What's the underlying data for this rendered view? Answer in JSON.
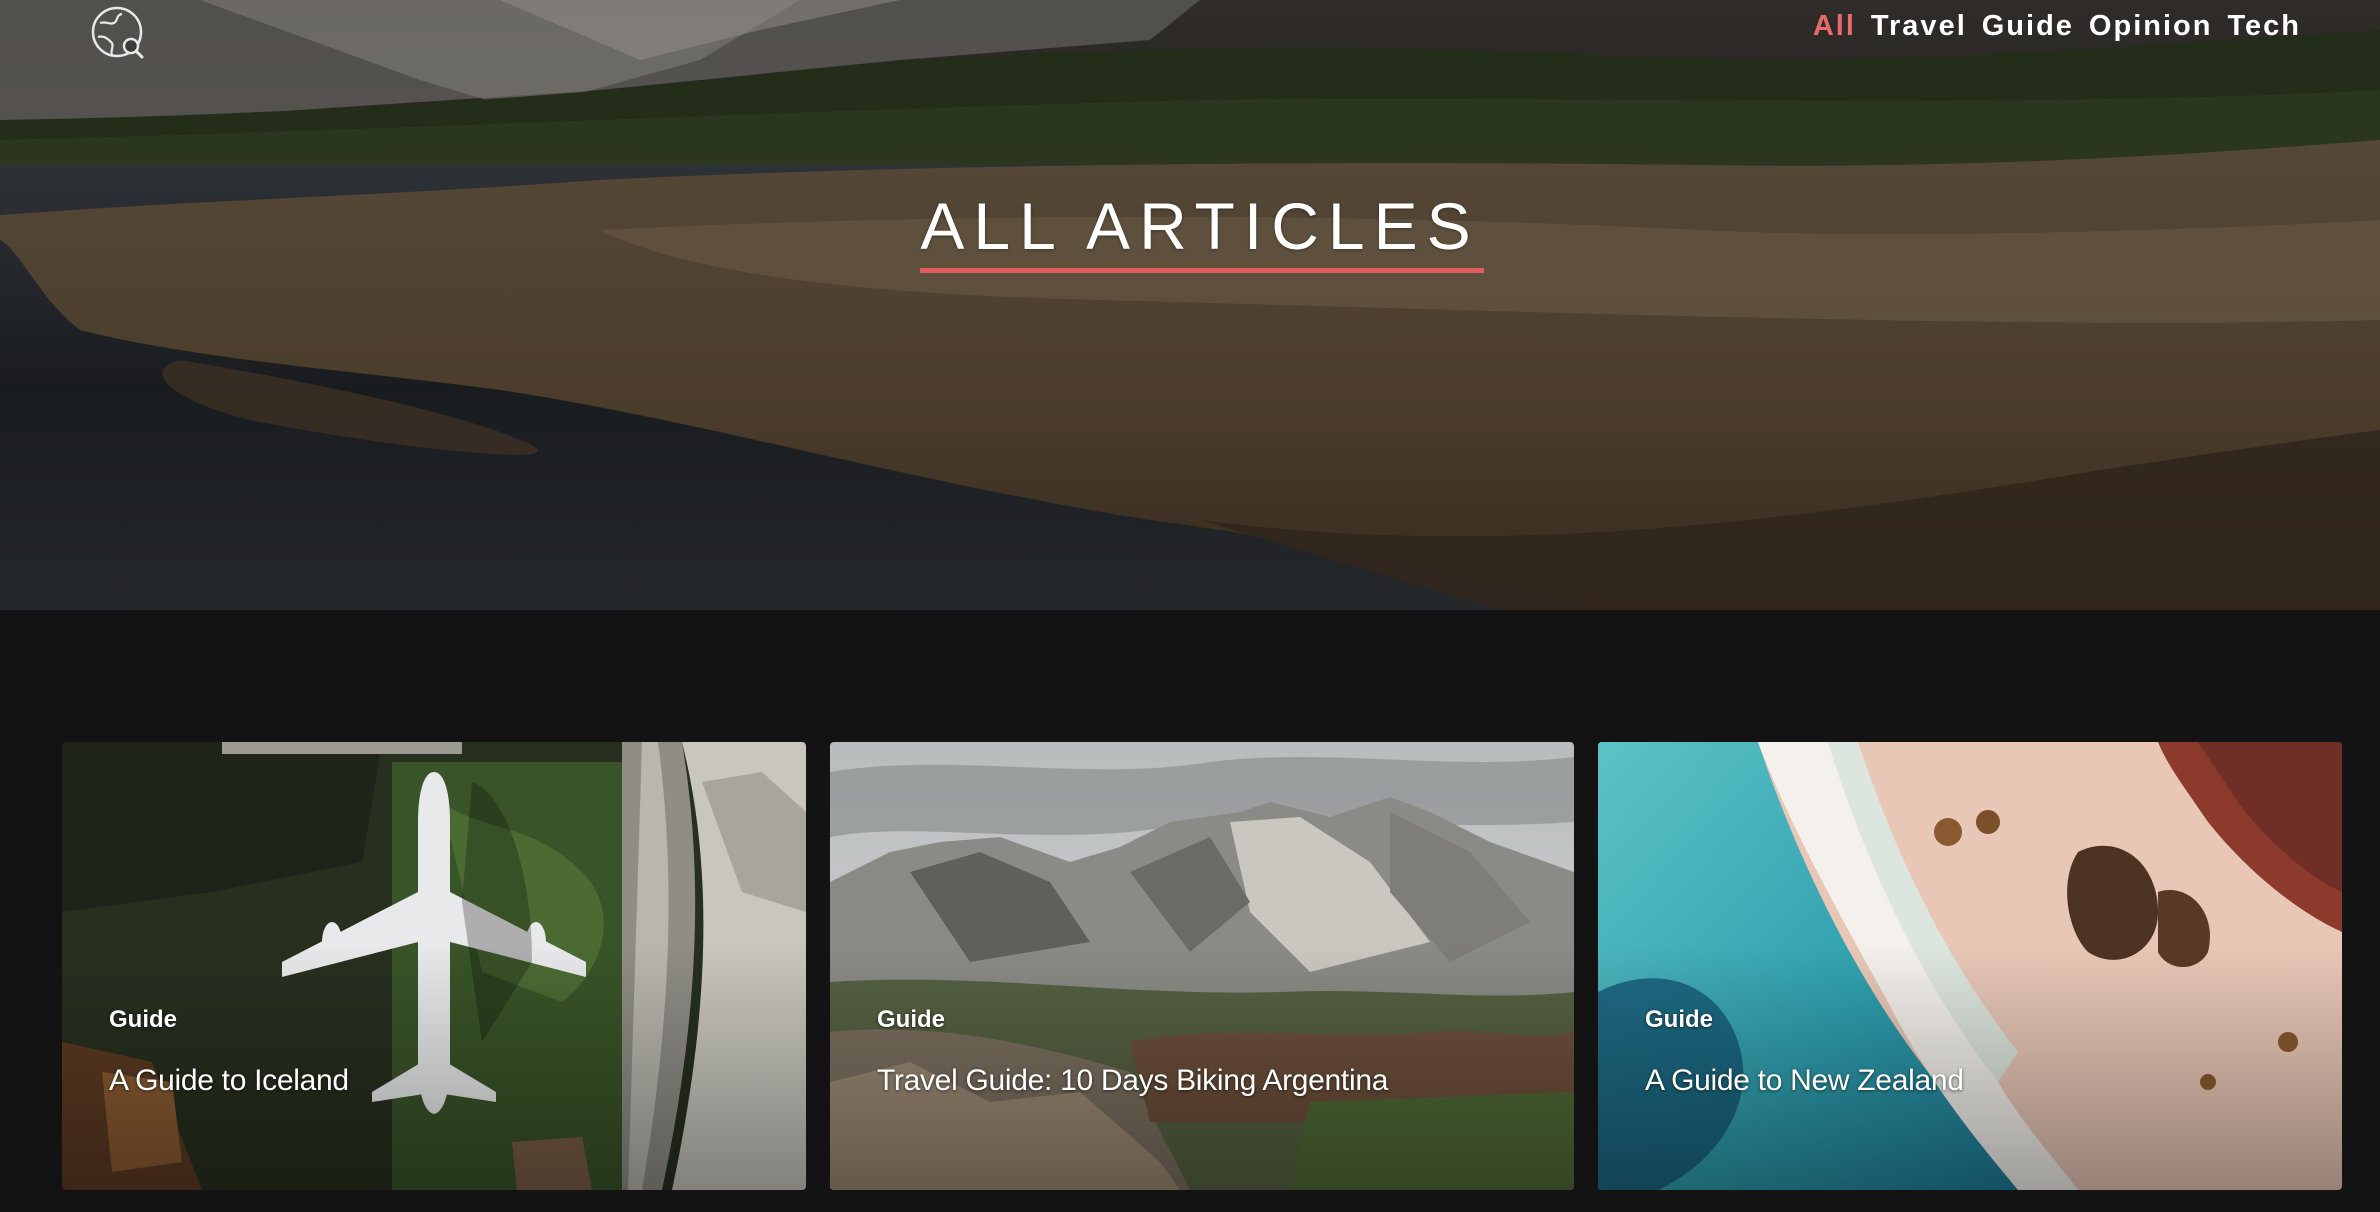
{
  "header": {
    "logo_icon": "globe-search-icon",
    "nav": [
      {
        "label": "All",
        "active": true
      },
      {
        "label": "Travel",
        "active": false
      },
      {
        "label": "Guide",
        "active": false
      },
      {
        "label": "Opinion",
        "active": false
      },
      {
        "label": "Tech",
        "active": false
      }
    ]
  },
  "hero": {
    "title": "ALL ARTICLES",
    "accent_color": "#e25b5e"
  },
  "articles": [
    {
      "category": "Guide",
      "title": "A Guide to Iceland",
      "image": "aerial airplane on runway"
    },
    {
      "category": "Guide",
      "title": "Travel Guide: 10 Days Biking Argentina",
      "image": "rocky mountain range"
    },
    {
      "category": "Guide",
      "title": "A Guide to New Zealand",
      "image": "aerial turquoise beach"
    }
  ],
  "colors": {
    "background": "#131313",
    "nav_active": "#e96a6c",
    "text": "#ffffff"
  }
}
